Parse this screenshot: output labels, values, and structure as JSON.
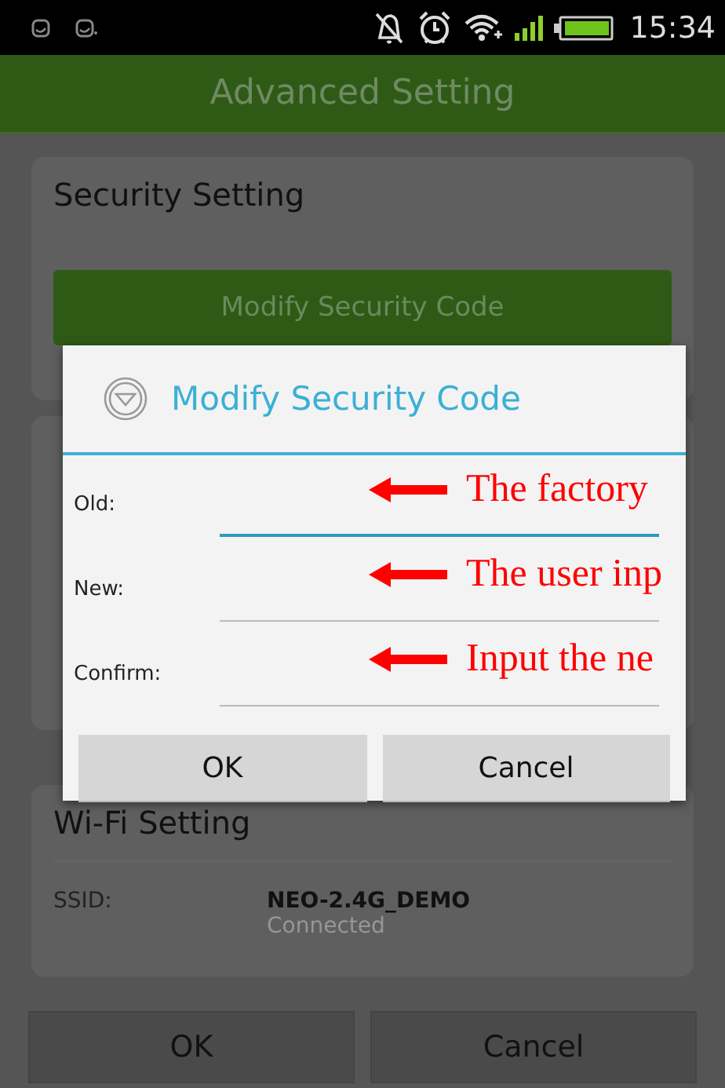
{
  "status_bar": {
    "time": "15:34"
  },
  "title_bar": {
    "title": "Advanced Setting"
  },
  "security_card": {
    "heading": "Security Setting",
    "button": "Modify Security Code"
  },
  "wifi_card": {
    "heading": "Wi-Fi Setting",
    "rows": [
      {
        "label": "SSID:",
        "value": "NEO-2.4G_DEMO",
        "status": "Connected"
      }
    ]
  },
  "bottom_buttons": [
    "OK",
    "Cancel"
  ],
  "dialog": {
    "title": "Modify Security Code",
    "fields": [
      {
        "label": "Old:",
        "focused": true,
        "annotation": "The factory"
      },
      {
        "label": "New:",
        "focused": false,
        "annotation": "The user inp"
      },
      {
        "label": "Confirm:",
        "focused": false,
        "annotation": "Input the ne"
      }
    ],
    "buttons": [
      "OK",
      "Cancel"
    ]
  }
}
